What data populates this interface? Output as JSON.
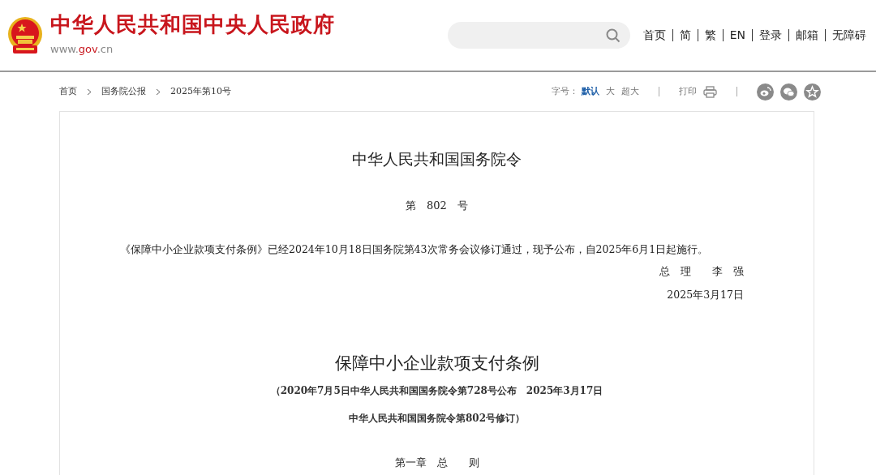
{
  "header": {
    "site_name": "中华人民共和国中央人民政府",
    "url": {
      "prefix": "www.",
      "domain": "gov",
      "suffix": ".cn"
    },
    "nav_links": [
      "首页",
      "简",
      "繁",
      "EN",
      "登录",
      "邮箱",
      "无障碍"
    ]
  },
  "breadcrumb": [
    "首页",
    "国务院公报",
    "2025年第10号"
  ],
  "tools": {
    "font_size_label": "字号：",
    "font_sizes": [
      {
        "label": "默认",
        "selected": true
      },
      {
        "label": "大",
        "selected": false
      },
      {
        "label": "超大",
        "selected": false
      }
    ],
    "print_label": "打印"
  },
  "document": {
    "title": "中华人民共和国国务院令",
    "number": "第　802　号",
    "preamble": "《保障中小企业款项支付条例》已经2024年10月18日国务院第43次常务会议修订通过，现予公布，自2025年6月1日起施行。",
    "signature": "总　理　　李　强",
    "date": "2025年3月17日",
    "regulation_title": "保障中小企业款项支付条例",
    "subtitle_lines": [
      "（2020年7月5日中华人民共和国国务院令第728号公布　2025年3月17日",
      "中华人民共和国国务院令第802号修订）"
    ],
    "chapter": "第一章　总　　则"
  }
}
